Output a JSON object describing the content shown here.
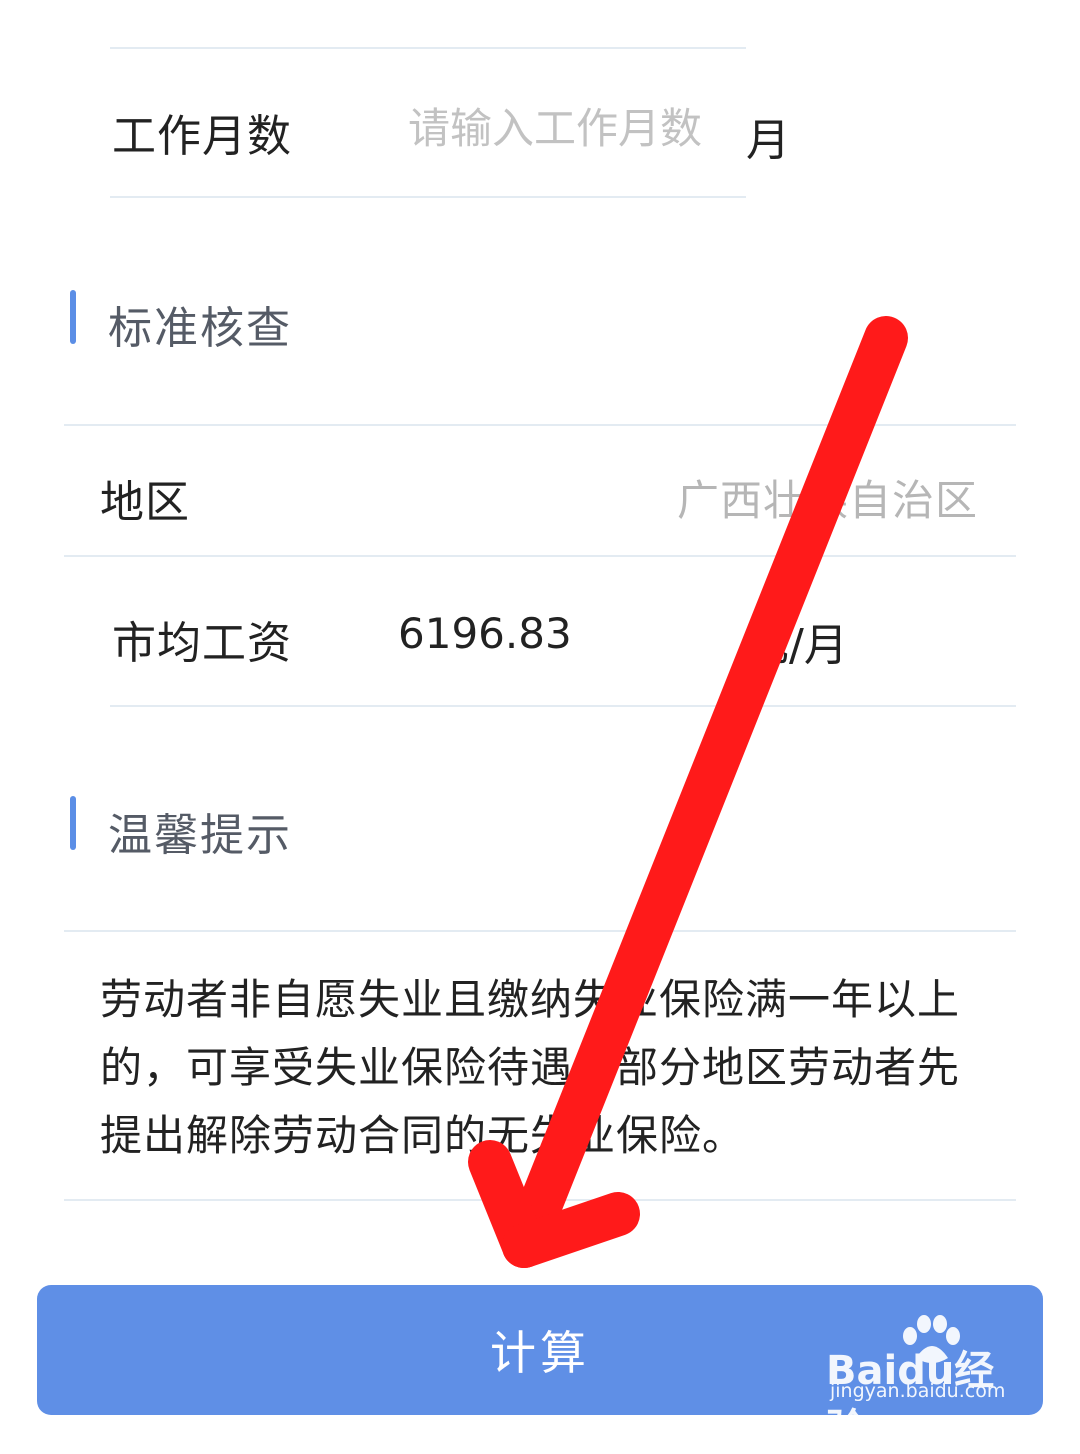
{
  "form": {
    "work_months_label": "工作月数",
    "work_months_placeholder": "请输入工作月数",
    "work_months_unit": "月"
  },
  "standard_check": {
    "title": "标准核查",
    "region_label": "地区",
    "region_value": "广西壮族自治区",
    "avg_wage_label": "市均工资",
    "avg_wage_value": "6196.83",
    "avg_wage_unit": "元/月"
  },
  "tips": {
    "title": "温馨提示",
    "text": "劳动者非自愿失业且缴纳失业保险满一年以上的，可享受失业保险待遇。部分地区劳动者先提出解除劳动合同的无失业保险。"
  },
  "calculate_button": {
    "label": "计算"
  },
  "watermark": {
    "brand": "Baidu经验",
    "url": "jingyan.baidu.com"
  },
  "colors": {
    "accent": "#5f8fe6",
    "section_bar": "#5b8ee6",
    "annotation_arrow": "#ff1a1a",
    "divider": "#e3ebf2"
  }
}
